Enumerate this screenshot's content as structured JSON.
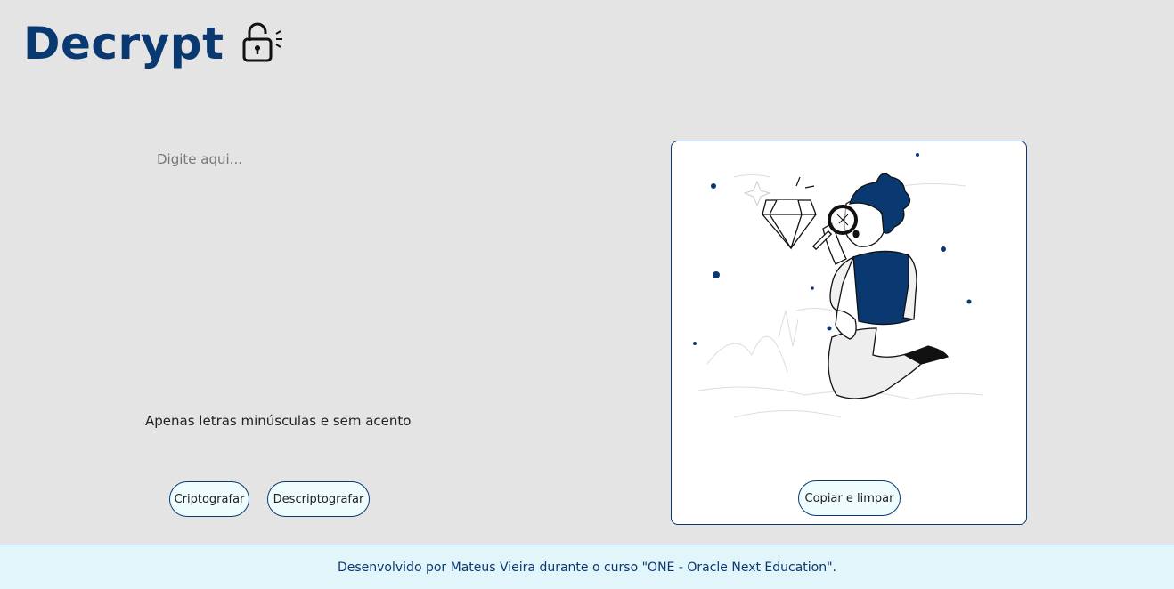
{
  "header": {
    "title": "Decrypt",
    "icon": "unlocked-padlock-icon"
  },
  "input": {
    "placeholder": "Digite aqui...",
    "value": ""
  },
  "hint": "Apenas letras minúsculas e sem acento",
  "buttons": {
    "encrypt": "Criptografar",
    "decrypt": "Descriptografar",
    "copy_clear": "Copiar e limpar"
  },
  "output": {
    "illustration": "person-with-magnifying-glass-and-diamond"
  },
  "footer": {
    "text": "Desenvolvido por Mateus Vieira durante o curso \"ONE - Oracle Next Education\"."
  },
  "colors": {
    "primary": "#0a3871",
    "background": "#e4e4e4",
    "footer_bg": "#e1f5fb",
    "button_bg": "#eefcfd"
  }
}
